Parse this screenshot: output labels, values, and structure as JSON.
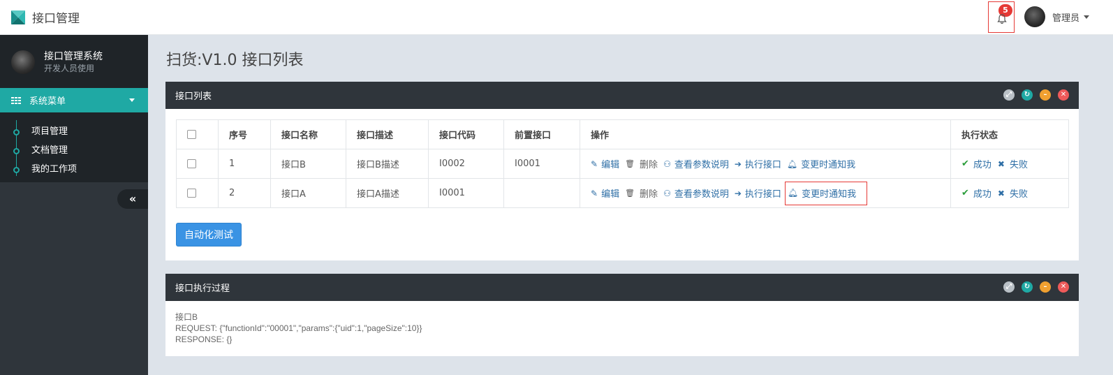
{
  "app": {
    "title": "接口管理"
  },
  "header": {
    "notification_count": "5",
    "user_name": "管理员"
  },
  "sidebar": {
    "profile_name": "接口管理系统",
    "profile_subtitle": "开发人员使用",
    "menu_label": "系统菜单",
    "items": [
      {
        "label": "项目管理"
      },
      {
        "label": "文档管理"
      },
      {
        "label": "我的工作项"
      }
    ],
    "collapse_glyph": "«"
  },
  "page": {
    "title": "扫货:V1.0 接口列表"
  },
  "list_panel": {
    "title": "接口列表",
    "columns": [
      "序号",
      "接口名称",
      "接口描述",
      "接口代码",
      "前置接口",
      "操作",
      "执行状态"
    ],
    "actions": {
      "edit": "编辑",
      "delete": "删除",
      "view_params": "查看参数说明",
      "execute": "执行接口",
      "notify": "变更时通知我"
    },
    "status": {
      "success": "成功",
      "fail": "失败"
    },
    "rows": [
      {
        "index": "1",
        "name": "接口B",
        "desc": "接口B描述",
        "code": "I0002",
        "pre": "I0001"
      },
      {
        "index": "2",
        "name": "接口A",
        "desc": "接口A描述",
        "code": "I0001",
        "pre": ""
      }
    ],
    "auto_test_label": "自动化测试"
  },
  "process_panel": {
    "title": "接口执行过程",
    "lines": [
      "接口B",
      "REQUEST: {\"functionId\":\"00001\",\"params\":{\"uid\":1,\"pageSize\":10}}",
      "RESPONSE: {}"
    ]
  },
  "colors": {
    "accent": "#1fa9a4",
    "dark": "#2f353b",
    "primary_button": "#3a93e4",
    "highlight_border": "#e53935"
  }
}
